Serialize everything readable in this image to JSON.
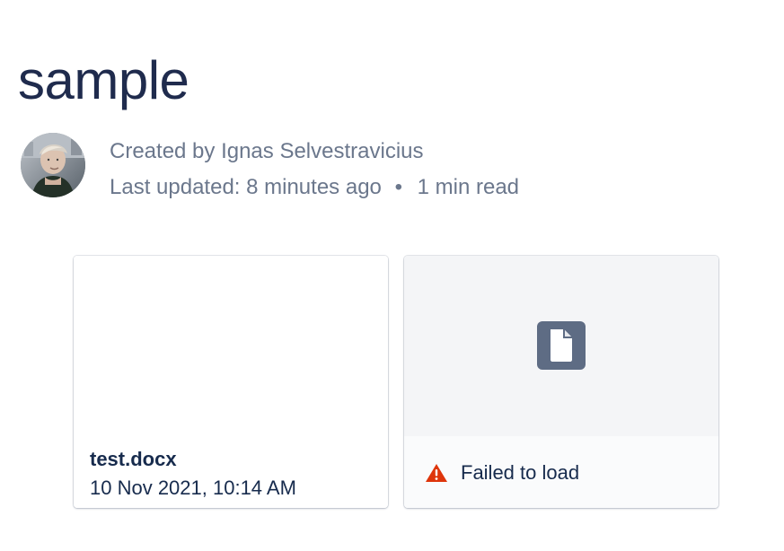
{
  "page": {
    "title": "sample"
  },
  "byline": {
    "created_by": "Created by Ignas Selvestravicius",
    "last_updated": "Last updated: 8 minutes ago",
    "separator": "•",
    "read_time": "1 min read"
  },
  "attachments": {
    "items": [
      {
        "name": "test.docx",
        "date": "10 Nov 2021, 10:14 AM"
      },
      {
        "status_text": "Failed to load",
        "icon": "file-icon",
        "status_icon": "warning-icon"
      }
    ]
  },
  "colors": {
    "title": "#1f2b4d",
    "meta": "#6b778c",
    "file_icon_bg": "#5e6c84",
    "warning": "#de350b",
    "preview_bg": "#f4f5f7"
  }
}
